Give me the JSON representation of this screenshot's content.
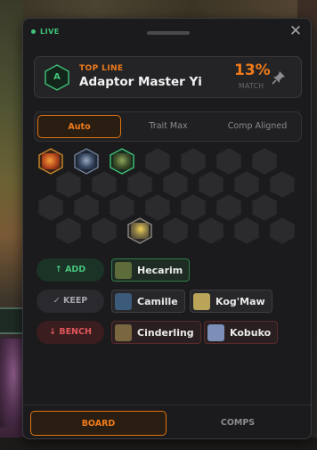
{
  "status": {
    "live_label": "LIVE"
  },
  "champion": {
    "badge_letter": "A",
    "role": "TOP LINE",
    "name": "Adaptor Master Yi",
    "match_percent": "13%",
    "match_label": "MATCH"
  },
  "tabs": [
    {
      "label": "Auto",
      "active": true
    },
    {
      "label": "Trait Max",
      "active": false
    },
    {
      "label": "Comp Aligned",
      "active": false
    }
  ],
  "board": {
    "rows": [
      [
        "unit-fiery",
        "unit-blue",
        "unit-green-selected",
        "empty",
        "empty",
        "empty",
        "empty"
      ],
      [
        "empty",
        "empty",
        "empty",
        "empty",
        "empty",
        "empty",
        "empty"
      ],
      [
        "empty",
        "empty",
        "empty",
        "empty",
        "empty",
        "empty",
        "empty"
      ],
      [
        "empty",
        "empty",
        "unit-gold",
        "empty",
        "empty",
        "empty",
        "empty"
      ]
    ]
  },
  "actions": {
    "add": {
      "label": "↑ ADD",
      "champions": [
        {
          "name": "Hecarim",
          "portrait_color": "#5e6b3a"
        }
      ]
    },
    "keep": {
      "label": "✓ KEEP",
      "champions": [
        {
          "name": "Camille",
          "portrait_color": "#3c5a7a"
        },
        {
          "name": "Kog'Maw",
          "portrait_color": "#b9a45a"
        }
      ]
    },
    "bench": {
      "label": "↓ BENCH",
      "champions": [
        {
          "name": "Cinderling",
          "portrait_color": "#7a6640"
        },
        {
          "name": "Kobuko",
          "portrait_color": "#7c8fb8"
        }
      ]
    }
  },
  "bottom_tabs": [
    {
      "label": "BOARD",
      "active": true
    },
    {
      "label": "COMPS",
      "active": false
    }
  ],
  "colors": {
    "accent": "#f07a1a",
    "live": "#3fc47a",
    "add": "#47c37c",
    "bench": "#e0575b"
  }
}
